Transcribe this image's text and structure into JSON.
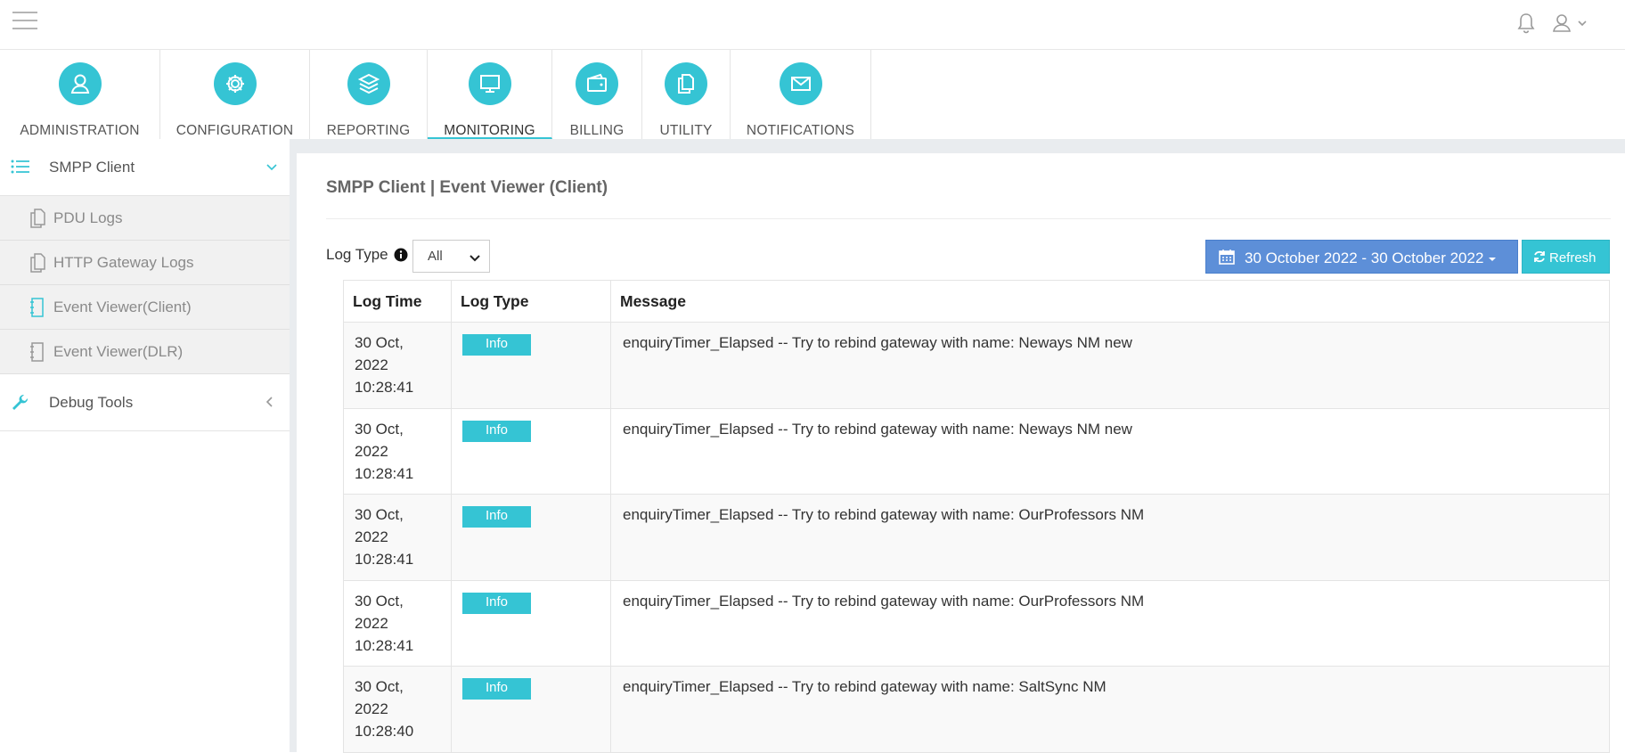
{
  "modules": [
    {
      "label": "ADMINISTRATION",
      "icon": "user-icon"
    },
    {
      "label": "CONFIGURATION",
      "icon": "gear-icon"
    },
    {
      "label": "REPORTING",
      "icon": "layers-icon"
    },
    {
      "label": "MONITORING",
      "icon": "monitor-icon",
      "active": true
    },
    {
      "label": "BILLING",
      "icon": "wallet-icon"
    },
    {
      "label": "UTILITY",
      "icon": "documents-icon"
    },
    {
      "label": "NOTIFICATIONS",
      "icon": "envelope-icon"
    }
  ],
  "sidebar": {
    "group1": "SMPP Client",
    "items": [
      "PDU Logs",
      "HTTP Gateway Logs",
      "Event Viewer(Client)",
      "Event Viewer(DLR)"
    ],
    "group2": "Debug Tools"
  },
  "page": {
    "title": "SMPP Client | Event Viewer (Client)",
    "log_type_label": "Log Type",
    "log_type_value": "All",
    "date_range": "30 October 2022 - 30 October 2022",
    "refresh_label": "Refresh"
  },
  "table": {
    "headers": [
      "Log Time",
      "Log Type",
      "Message"
    ],
    "rows": [
      {
        "date": "30 Oct,",
        "year": "2022",
        "time": "10:28:41",
        "type": "Info",
        "message": "enquiryTimer_Elapsed -- Try to rebind gateway with name: Neways NM new"
      },
      {
        "date": "30 Oct,",
        "year": "2022",
        "time": "10:28:41",
        "type": "Info",
        "message": "enquiryTimer_Elapsed -- Try to rebind gateway with name: Neways NM new"
      },
      {
        "date": "30 Oct,",
        "year": "2022",
        "time": "10:28:41",
        "type": "Info",
        "message": "enquiryTimer_Elapsed -- Try to rebind gateway with name: OurProfessors NM"
      },
      {
        "date": "30 Oct,",
        "year": "2022",
        "time": "10:28:41",
        "type": "Info",
        "message": "enquiryTimer_Elapsed -- Try to rebind gateway with name: OurProfessors NM"
      },
      {
        "date": "30 Oct,",
        "year": "2022",
        "time": "10:28:40",
        "type": "Info",
        "message": "enquiryTimer_Elapsed -- Try to rebind gateway with name: SaltSync NM"
      }
    ]
  },
  "colors": {
    "accent": "#35c4d4",
    "date_button": "#5d8fd8"
  }
}
